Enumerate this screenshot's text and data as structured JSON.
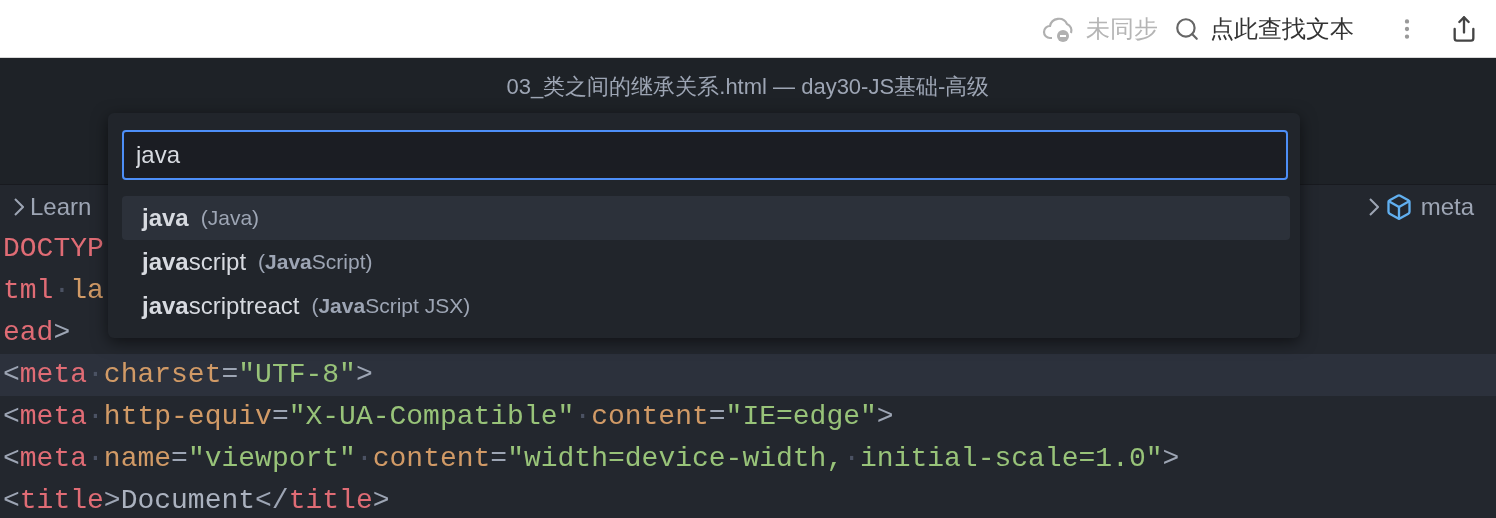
{
  "top_bar": {
    "sync_status": {
      "label": "未同步",
      "disabled": true
    },
    "find": {
      "label": "点此查找文本"
    }
  },
  "window": {
    "title": "03_类之间的继承关系.html — day30-JS基础-高级"
  },
  "breadcrumb": {
    "left": "Learn",
    "right": "meta"
  },
  "editor": {
    "lines": [
      {
        "current": false,
        "tokens": [
          {
            "kind": "tag",
            "text": "DOCTYP"
          }
        ]
      },
      {
        "current": false,
        "tokens": [
          {
            "kind": "tag",
            "text": "tml"
          },
          {
            "kind": "ws",
            "text": "·"
          },
          {
            "kind": "attr",
            "text": "la"
          }
        ]
      },
      {
        "current": false,
        "tokens": [
          {
            "kind": "tag",
            "text": "ead"
          },
          {
            "kind": "punct",
            "text": ">"
          }
        ]
      },
      {
        "current": true,
        "tokens": [
          {
            "kind": "punct",
            "text": "<"
          },
          {
            "kind": "tag",
            "text": "meta"
          },
          {
            "kind": "ws",
            "text": "·"
          },
          {
            "kind": "attr",
            "text": "charset"
          },
          {
            "kind": "punct",
            "text": "="
          },
          {
            "kind": "string",
            "text": "\"UTF-8\""
          },
          {
            "kind": "punct",
            "text": ">"
          }
        ]
      },
      {
        "current": false,
        "tokens": [
          {
            "kind": "punct",
            "text": "<"
          },
          {
            "kind": "tag",
            "text": "meta"
          },
          {
            "kind": "ws",
            "text": "·"
          },
          {
            "kind": "attr",
            "text": "http-equiv"
          },
          {
            "kind": "punct",
            "text": "="
          },
          {
            "kind": "string",
            "text": "\"X-UA-Compatible\""
          },
          {
            "kind": "ws",
            "text": "·"
          },
          {
            "kind": "attr",
            "text": "content"
          },
          {
            "kind": "punct",
            "text": "="
          },
          {
            "kind": "string",
            "text": "\"IE=edge\""
          },
          {
            "kind": "punct",
            "text": ">"
          }
        ]
      },
      {
        "current": false,
        "tokens": [
          {
            "kind": "punct",
            "text": "<"
          },
          {
            "kind": "tag",
            "text": "meta"
          },
          {
            "kind": "ws",
            "text": "·"
          },
          {
            "kind": "attr",
            "text": "name"
          },
          {
            "kind": "punct",
            "text": "="
          },
          {
            "kind": "string",
            "text": "\"viewport\""
          },
          {
            "kind": "ws",
            "text": "·"
          },
          {
            "kind": "attr",
            "text": "content"
          },
          {
            "kind": "punct",
            "text": "="
          },
          {
            "kind": "string",
            "text": "\"width=device-width,"
          },
          {
            "kind": "ws",
            "text": "·"
          },
          {
            "kind": "string",
            "text": "initial-scale=1.0\""
          },
          {
            "kind": "punct",
            "text": ">"
          }
        ]
      },
      {
        "current": false,
        "tokens": [
          {
            "kind": "punct",
            "text": "<"
          },
          {
            "kind": "tag",
            "text": "title"
          },
          {
            "kind": "punct",
            "text": ">"
          },
          {
            "kind": "text",
            "text": "Document"
          },
          {
            "kind": "punct",
            "text": "</"
          },
          {
            "kind": "tag",
            "text": "title"
          },
          {
            "kind": "punct",
            "text": ">"
          }
        ]
      }
    ]
  },
  "language_picker": {
    "value": "java",
    "items": [
      {
        "name": "**java**",
        "detail": "(Java)",
        "selected": true
      },
      {
        "name": "**java**script",
        "detail": "(**Java**Script)",
        "selected": false
      },
      {
        "name": "**java**scriptreact",
        "detail": "(**Java**Script JSX)",
        "selected": false
      }
    ]
  }
}
